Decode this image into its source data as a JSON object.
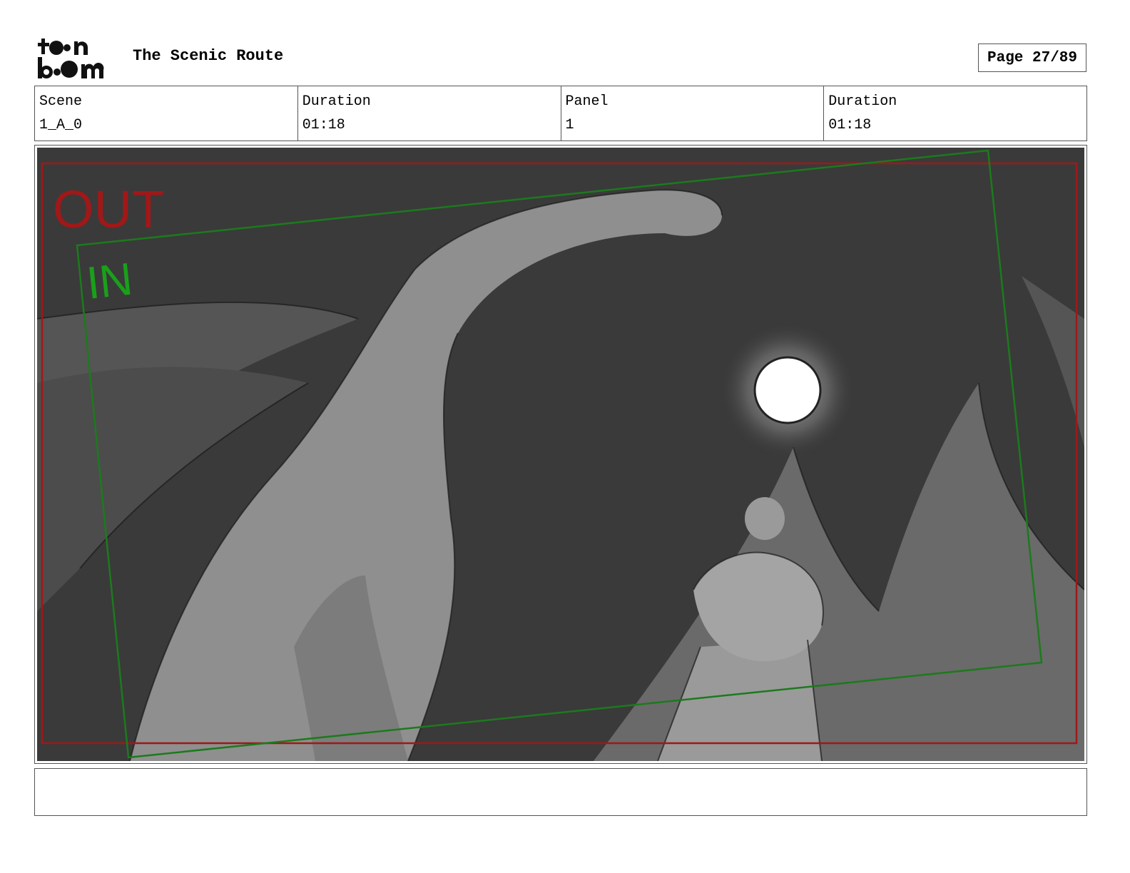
{
  "header": {
    "logo_text": "toon boom",
    "project_title": "The Scenic Route",
    "page_label": "Page 27/89"
  },
  "info": {
    "scene_label": "Scene",
    "scene_value": "1_A_0",
    "scene_duration_label": "Duration",
    "scene_duration_value": "01:18",
    "panel_label": "Panel",
    "panel_value": "1",
    "panel_duration_label": "Duration",
    "panel_duration_value": "01:18"
  },
  "panel": {
    "out_label": "OUT",
    "in_label": "IN",
    "colors": {
      "out_frame": "#a01818",
      "in_frame": "#1c7a1c",
      "in_text": "#1aa01a",
      "sky": "#3a3a3a",
      "creature": "#8f8f8f",
      "trees": "#6e6e6e",
      "moon": "#ffffff"
    }
  },
  "caption": {
    "text": ""
  }
}
